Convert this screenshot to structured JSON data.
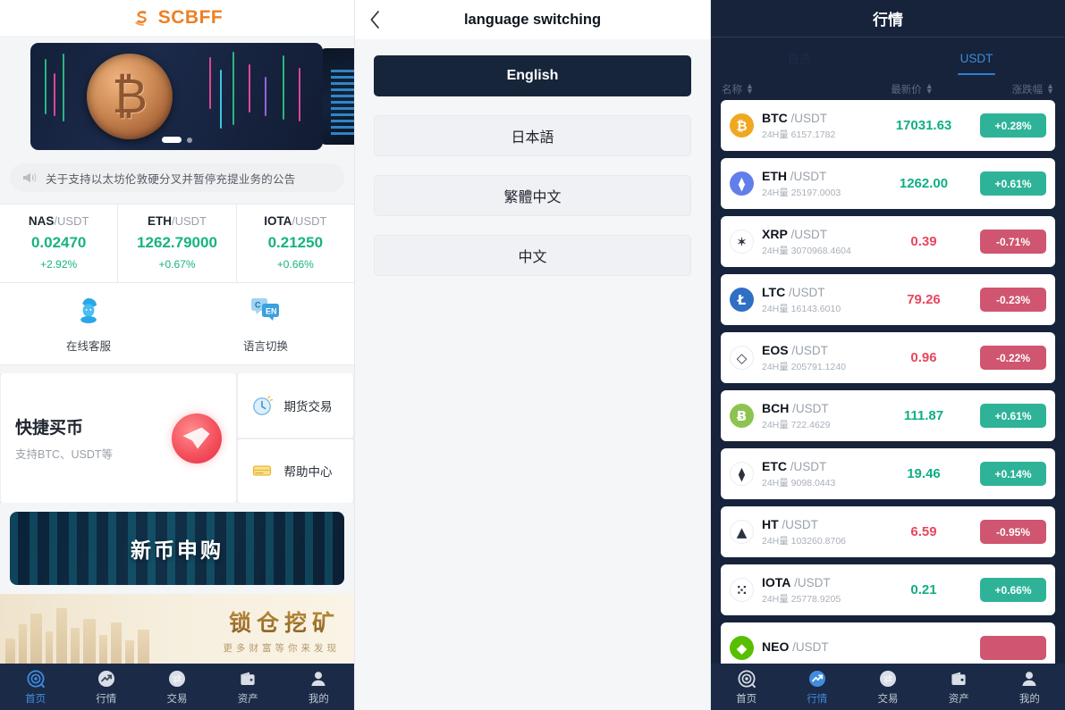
{
  "home": {
    "logo_text": "SCBFF",
    "notice": "关于支持以太坊伦敦硬分叉并暂停充提业务的公告",
    "tickers": [
      {
        "base": "NAS",
        "quote": "/USDT",
        "price": "0.02470",
        "change": "+2.92%"
      },
      {
        "base": "ETH",
        "quote": "/USDT",
        "price": "1262.79000",
        "change": "+0.67%"
      },
      {
        "base": "IOTA",
        "quote": "/USDT",
        "price": "0.21250",
        "change": "+0.66%"
      }
    ],
    "quick_icons": [
      {
        "label": "在线客服"
      },
      {
        "label": "语言切换"
      }
    ],
    "promo_big": {
      "title": "快捷买币",
      "subtitle": "支持BTC、USDT等"
    },
    "promo_cells": [
      {
        "label": "期货交易"
      },
      {
        "label": "帮助中心"
      }
    ],
    "banner_new": "新币申购",
    "banner_lock": {
      "title": "锁仓挖矿",
      "subtitle": "更多财富等你来发现"
    },
    "tabbar": [
      {
        "label": "首页",
        "icon": "home-icon",
        "active": true
      },
      {
        "label": "行情",
        "icon": "market-icon",
        "active": false
      },
      {
        "label": "交易",
        "icon": "trade-icon",
        "active": false
      },
      {
        "label": "资产",
        "icon": "assets-icon",
        "active": false
      },
      {
        "label": "我的",
        "icon": "profile-icon",
        "active": false
      }
    ]
  },
  "language": {
    "title": "language switching",
    "back_icon": "chevron-left-icon",
    "options": [
      {
        "label": "English",
        "selected": true
      },
      {
        "label": "日本語",
        "selected": false
      },
      {
        "label": "繁體中文",
        "selected": false
      },
      {
        "label": "中文",
        "selected": false
      }
    ]
  },
  "market": {
    "title": "行情",
    "tabs": [
      {
        "label": "自选",
        "active": false
      },
      {
        "label": "USDT",
        "active": true
      }
    ],
    "columns": [
      {
        "label": "名称"
      },
      {
        "label": "最新价"
      },
      {
        "label": "涨跌幅"
      }
    ],
    "rows": [
      {
        "symbol": "BTC",
        "quote": "/USDT",
        "vol": "24H量 6157.1782",
        "price": "17031.63",
        "change": "+0.28%",
        "dir": "up",
        "color": "#f0a820",
        "glyph": "₿"
      },
      {
        "symbol": "ETH",
        "quote": "/USDT",
        "vol": "24H量 25197.0003",
        "price": "1262.00",
        "change": "+0.61%",
        "dir": "up",
        "color": "#627eea",
        "glyph": "⧫"
      },
      {
        "symbol": "XRP",
        "quote": "/USDT",
        "vol": "24H量 3070968.4604",
        "price": "0.39",
        "change": "-0.71%",
        "dir": "down",
        "color": "#ffffff",
        "glyph": "✶"
      },
      {
        "symbol": "LTC",
        "quote": "/USDT",
        "vol": "24H量 16143.6010",
        "price": "79.26",
        "change": "-0.23%",
        "dir": "down",
        "color": "#2f6fc4",
        "glyph": "Ł"
      },
      {
        "symbol": "EOS",
        "quote": "/USDT",
        "vol": "24H量 205791.1240",
        "price": "0.96",
        "change": "-0.22%",
        "dir": "down",
        "color": "#ffffff",
        "glyph": "◇"
      },
      {
        "symbol": "BCH",
        "quote": "/USDT",
        "vol": "24H量 722.4629",
        "price": "111.87",
        "change": "+0.61%",
        "dir": "up",
        "color": "#8dc351",
        "glyph": "Ƀ"
      },
      {
        "symbol": "ETC",
        "quote": "/USDT",
        "vol": "24H量 9098.0443",
        "price": "19.46",
        "change": "+0.14%",
        "dir": "up",
        "color": "#ffffff",
        "glyph": "⧫"
      },
      {
        "symbol": "HT",
        "quote": "/USDT",
        "vol": "24H量 103260.8706",
        "price": "6.59",
        "change": "-0.95%",
        "dir": "down",
        "color": "#ffffff",
        "glyph": "▲"
      },
      {
        "symbol": "IOTA",
        "quote": "/USDT",
        "vol": "24H量 25778.9205",
        "price": "0.21",
        "change": "+0.66%",
        "dir": "up",
        "color": "#ffffff",
        "glyph": "⁙"
      },
      {
        "symbol": "NEO",
        "quote": "/USDT",
        "vol": "",
        "price": "",
        "change": "",
        "dir": "down",
        "color": "#58bf00",
        "glyph": "◆"
      }
    ],
    "tabbar": [
      {
        "label": "首页",
        "icon": "home-icon",
        "active": false
      },
      {
        "label": "行情",
        "icon": "market-icon",
        "active": true
      },
      {
        "label": "交易",
        "icon": "trade-icon",
        "active": false
      },
      {
        "label": "资产",
        "icon": "assets-icon",
        "active": false
      },
      {
        "label": "我的",
        "icon": "profile-icon",
        "active": false
      }
    ]
  },
  "colors": {
    "brand_orange": "#ee8023",
    "up_green": "#0fae85",
    "down_red": "#e8465e",
    "badge_up": "#2eb398",
    "badge_down": "#cf5570",
    "nav_dark": "#1b2a47",
    "market_bg": "#16233a",
    "accent_blue": "#3f8de0"
  }
}
